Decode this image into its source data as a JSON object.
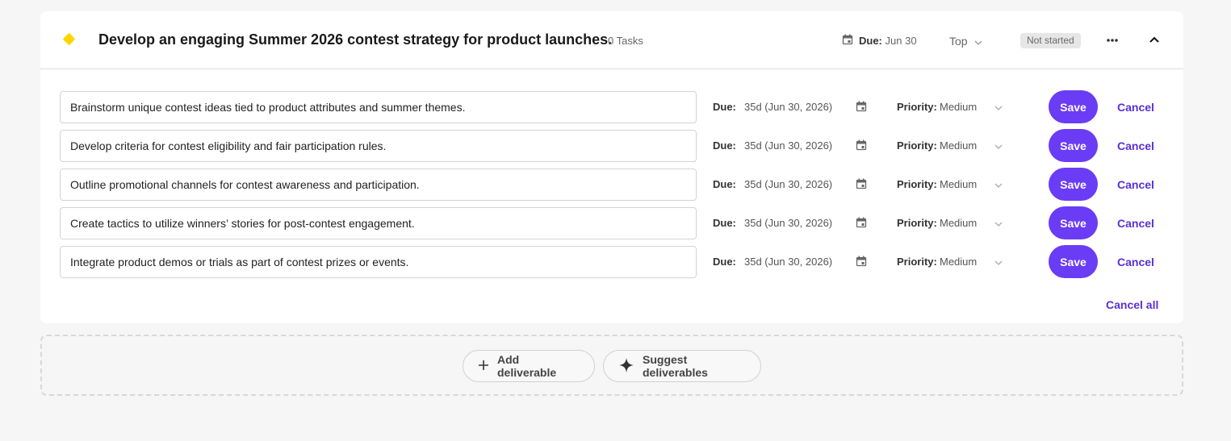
{
  "goal": {
    "title": "Develop an engaging Summer 2026 contest strategy for product launches.",
    "task_count": "0 Tasks",
    "due_label": "Due:",
    "due_value": "Jun 30",
    "priority": "Top",
    "status": "Not started",
    "accent_color": "#ffd600"
  },
  "deliverables": [
    {
      "text": "Brainstorm unique contest ideas tied to product attributes and summer themes.",
      "due_label": "Due:",
      "due_value": "35d (Jun 30, 2026)",
      "priority_label": "Priority:",
      "priority_value": "Medium",
      "save_label": "Save",
      "cancel_label": "Cancel"
    },
    {
      "text": "Develop criteria for contest eligibility and fair participation rules.",
      "due_label": "Due:",
      "due_value": "35d (Jun 30, 2026)",
      "priority_label": "Priority:",
      "priority_value": "Medium",
      "save_label": "Save",
      "cancel_label": "Cancel"
    },
    {
      "text": "Outline promotional channels for contest awareness and participation.",
      "due_label": "Due:",
      "due_value": "35d (Jun 30, 2026)",
      "priority_label": "Priority:",
      "priority_value": "Medium",
      "save_label": "Save",
      "cancel_label": "Cancel"
    },
    {
      "text": "Create tactics to utilize winners’ stories for post-contest engagement.",
      "due_label": "Due:",
      "due_value": "35d (Jun 30, 2026)",
      "priority_label": "Priority:",
      "priority_value": "Medium",
      "save_label": "Save",
      "cancel_label": "Cancel"
    },
    {
      "text": "Integrate product demos or trials as part of contest prizes or events.",
      "due_label": "Due:",
      "due_value": "35d (Jun 30, 2026)",
      "priority_label": "Priority:",
      "priority_value": "Medium",
      "save_label": "Save",
      "cancel_label": "Cancel"
    }
  ],
  "cancel_all_label": "Cancel all",
  "actions": {
    "add_label": "Add deliverable",
    "suggest_label": "Suggest deliverables"
  },
  "colors": {
    "primary": "#6b3cf5",
    "link": "#5a2fd6",
    "status_bg": "#e6e6e6"
  },
  "icons": [
    "diamond-icon",
    "calendar-icon",
    "chevron-down-icon",
    "more-horizontal-icon",
    "chevron-up-icon",
    "plus-icon",
    "sparkle-icon"
  ]
}
